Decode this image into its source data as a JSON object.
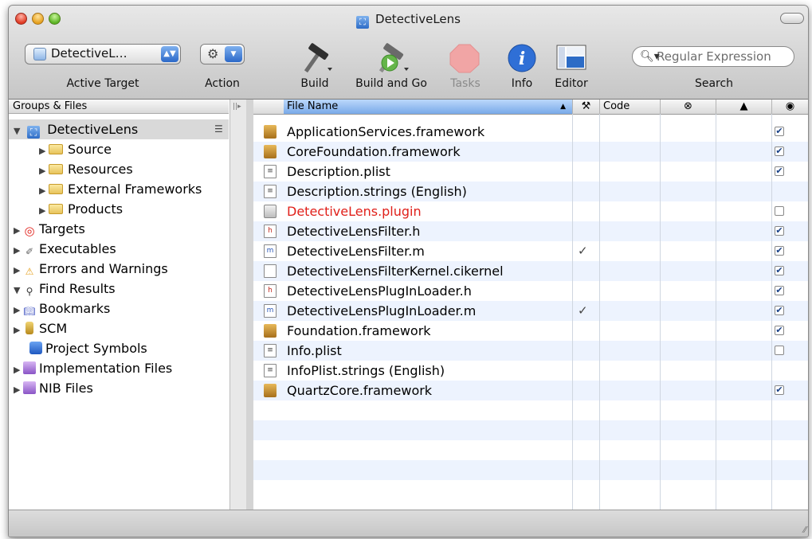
{
  "window": {
    "title": "DetectiveLens"
  },
  "toolbar": {
    "target_popup": "DetectiveL…",
    "target_label": "Active Target",
    "action_label": "Action",
    "build_label": "Build",
    "build_go_label": "Build and Go",
    "tasks_label": "Tasks",
    "info_label": "Info",
    "editor_label": "Editor",
    "search_placeholder": "Regular Expression",
    "search_label": "Search"
  },
  "sidebar": {
    "header": "Groups & Files",
    "items": [
      {
        "label": "DetectiveLens",
        "icon": "project-icon"
      },
      {
        "label": "Source",
        "icon": "folder-icon"
      },
      {
        "label": "Resources",
        "icon": "folder-icon"
      },
      {
        "label": "External Frameworks",
        "icon": "folder-icon"
      },
      {
        "label": "Products",
        "icon": "folder-icon"
      },
      {
        "label": "Targets",
        "icon": "target-icon"
      },
      {
        "label": "Executables",
        "icon": "executable-icon"
      },
      {
        "label": "Errors and Warnings",
        "icon": "warning-icon"
      },
      {
        "label": "Find Results",
        "icon": "magnifier-icon"
      },
      {
        "label": "Bookmarks",
        "icon": "bookmark-icon"
      },
      {
        "label": "SCM",
        "icon": "scm-icon"
      },
      {
        "label": "Project Symbols",
        "icon": "symbols-icon"
      },
      {
        "label": "Implementation Files",
        "icon": "smart-group-icon"
      },
      {
        "label": "NIB Files",
        "icon": "smart-group-icon"
      }
    ]
  },
  "columns": {
    "file_name": "File Name",
    "code": "Code"
  },
  "files": [
    {
      "name": "ApplicationServices.framework",
      "icon": "framework-icon",
      "checked": "☑"
    },
    {
      "name": "CoreFoundation.framework",
      "icon": "framework-icon",
      "checked": "☑"
    },
    {
      "name": "Description.plist",
      "icon": "plist-icon",
      "checked": "☑"
    },
    {
      "name": "Description.strings (English)",
      "icon": "strings-icon",
      "checked": ""
    },
    {
      "name": "DetectiveLens.plugin",
      "icon": "plugin-icon",
      "checked": "☐"
    },
    {
      "name": "DetectiveLensFilter.h",
      "icon": "header-icon",
      "checked": "☑"
    },
    {
      "name": "DetectiveLensFilter.m",
      "icon": "source-icon",
      "checked": "☑",
      "mark": "✓"
    },
    {
      "name": "DetectiveLensFilterKernel.cikernel",
      "icon": "document-icon",
      "checked": "☑"
    },
    {
      "name": "DetectiveLensPlugInLoader.h",
      "icon": "header-icon",
      "checked": "☑"
    },
    {
      "name": "DetectiveLensPlugInLoader.m",
      "icon": "source-icon",
      "checked": "☑",
      "mark": "✓"
    },
    {
      "name": "Foundation.framework",
      "icon": "framework-icon",
      "checked": "☑"
    },
    {
      "name": "Info.plist",
      "icon": "plist-icon",
      "checked": "☐"
    },
    {
      "name": "InfoPlist.strings (English)",
      "icon": "strings-icon",
      "checked": ""
    },
    {
      "name": "QuartzCore.framework",
      "icon": "framework-icon",
      "checked": "☑"
    }
  ],
  "colors": {
    "plugin_missing": "#e0201a",
    "selection": "#d9d9d9",
    "alt_row": "#edf3fe"
  }
}
